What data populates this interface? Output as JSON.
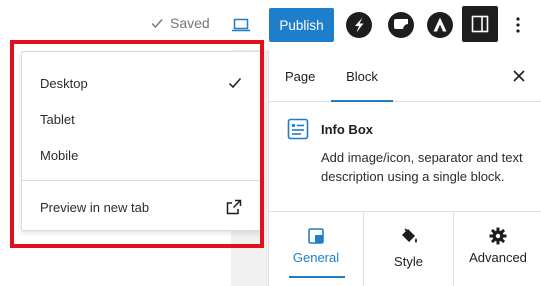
{
  "toolbar": {
    "saved_label": "Saved",
    "publish_label": "Publish",
    "publish_color": "#1e7ec9"
  },
  "preview_menu": {
    "items": [
      {
        "label": "Desktop",
        "selected": true
      },
      {
        "label": "Tablet",
        "selected": false
      },
      {
        "label": "Mobile",
        "selected": false
      }
    ],
    "preview_new_tab_label": "Preview in new tab",
    "highlight_color": "#e0111c"
  },
  "sidebar": {
    "tabs": [
      {
        "label": "Page",
        "active": false
      },
      {
        "label": "Block",
        "active": true
      }
    ],
    "block": {
      "title": "Info Box",
      "description": "Add image/icon, separator and text description using a single block."
    },
    "panel_tabs": [
      {
        "label": "General",
        "icon": "general-icon",
        "active": true
      },
      {
        "label": "Style",
        "icon": "paint-bucket-icon",
        "active": false
      },
      {
        "label": "Advanced",
        "icon": "gear-icon",
        "active": false
      }
    ]
  }
}
